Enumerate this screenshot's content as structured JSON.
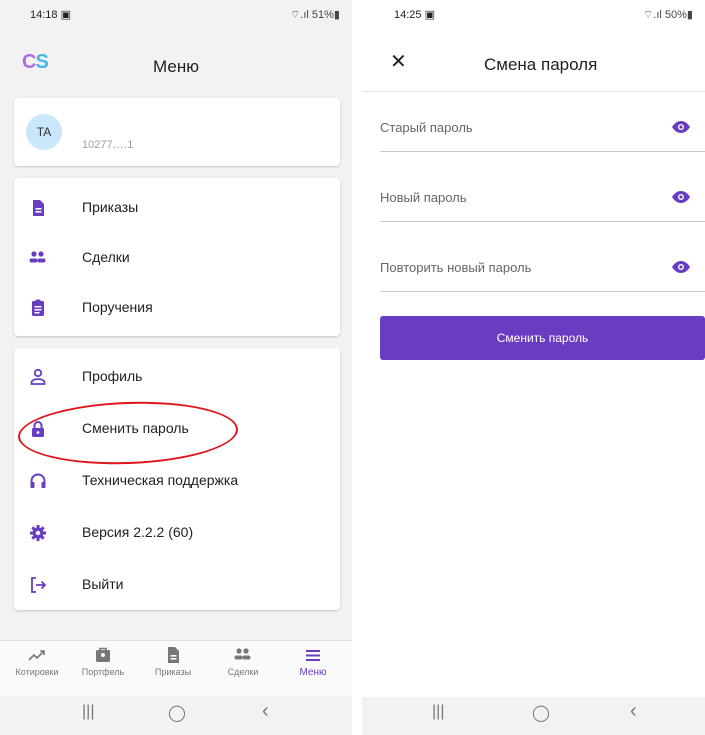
{
  "left": {
    "status": {
      "time": "14:18 ▣",
      "indicators": "⌔.ıl 51%▮"
    },
    "logo": {
      "c": "C",
      "s": "S"
    },
    "title": "Меню",
    "profile": {
      "initials": "TA",
      "account": "10277‥‥1"
    },
    "docs_menu": [
      {
        "label": "Приказы",
        "icon": "document-icon"
      },
      {
        "label": "Сделки",
        "icon": "people-icon"
      },
      {
        "label": "Поручения",
        "icon": "clipboard-icon"
      }
    ],
    "settings_menu": [
      {
        "label": "Профиль",
        "icon": "person-icon"
      },
      {
        "label": "Сменить пароль",
        "icon": "lock-icon"
      },
      {
        "label": "Техническая поддержка",
        "icon": "headset-icon"
      },
      {
        "label": "Версия 2.2.2 (60)",
        "icon": "gear-icon"
      },
      {
        "label": "Выйти",
        "icon": "logout-icon"
      }
    ],
    "bottom_nav": [
      {
        "label": "Котировки",
        "icon": "trend-icon"
      },
      {
        "label": "Портфель",
        "icon": "briefcase-icon"
      },
      {
        "label": "Приказы",
        "icon": "document-icon"
      },
      {
        "label": "Сделки",
        "icon": "people-icon"
      },
      {
        "label": "Меню",
        "icon": "hamburger-icon",
        "active": true
      }
    ],
    "sysnav": {
      "recent": "|||",
      "home": "◯",
      "back": "‹"
    }
  },
  "right": {
    "status": {
      "time": "14:25 ▣",
      "indicators": "⌔.ıl 50%▮"
    },
    "close": "✕",
    "title": "Смена пароля",
    "fields": [
      {
        "placeholder": "Старый пароль"
      },
      {
        "placeholder": "Новый пароль"
      },
      {
        "placeholder": "Повторить новый пароль"
      }
    ],
    "submit_label": "Сменить пароль",
    "sysnav": {
      "recent": "|||",
      "home": "◯",
      "back": "‹"
    }
  },
  "colors": {
    "accent": "#6a3cc2",
    "annotation": "#e0151c"
  }
}
